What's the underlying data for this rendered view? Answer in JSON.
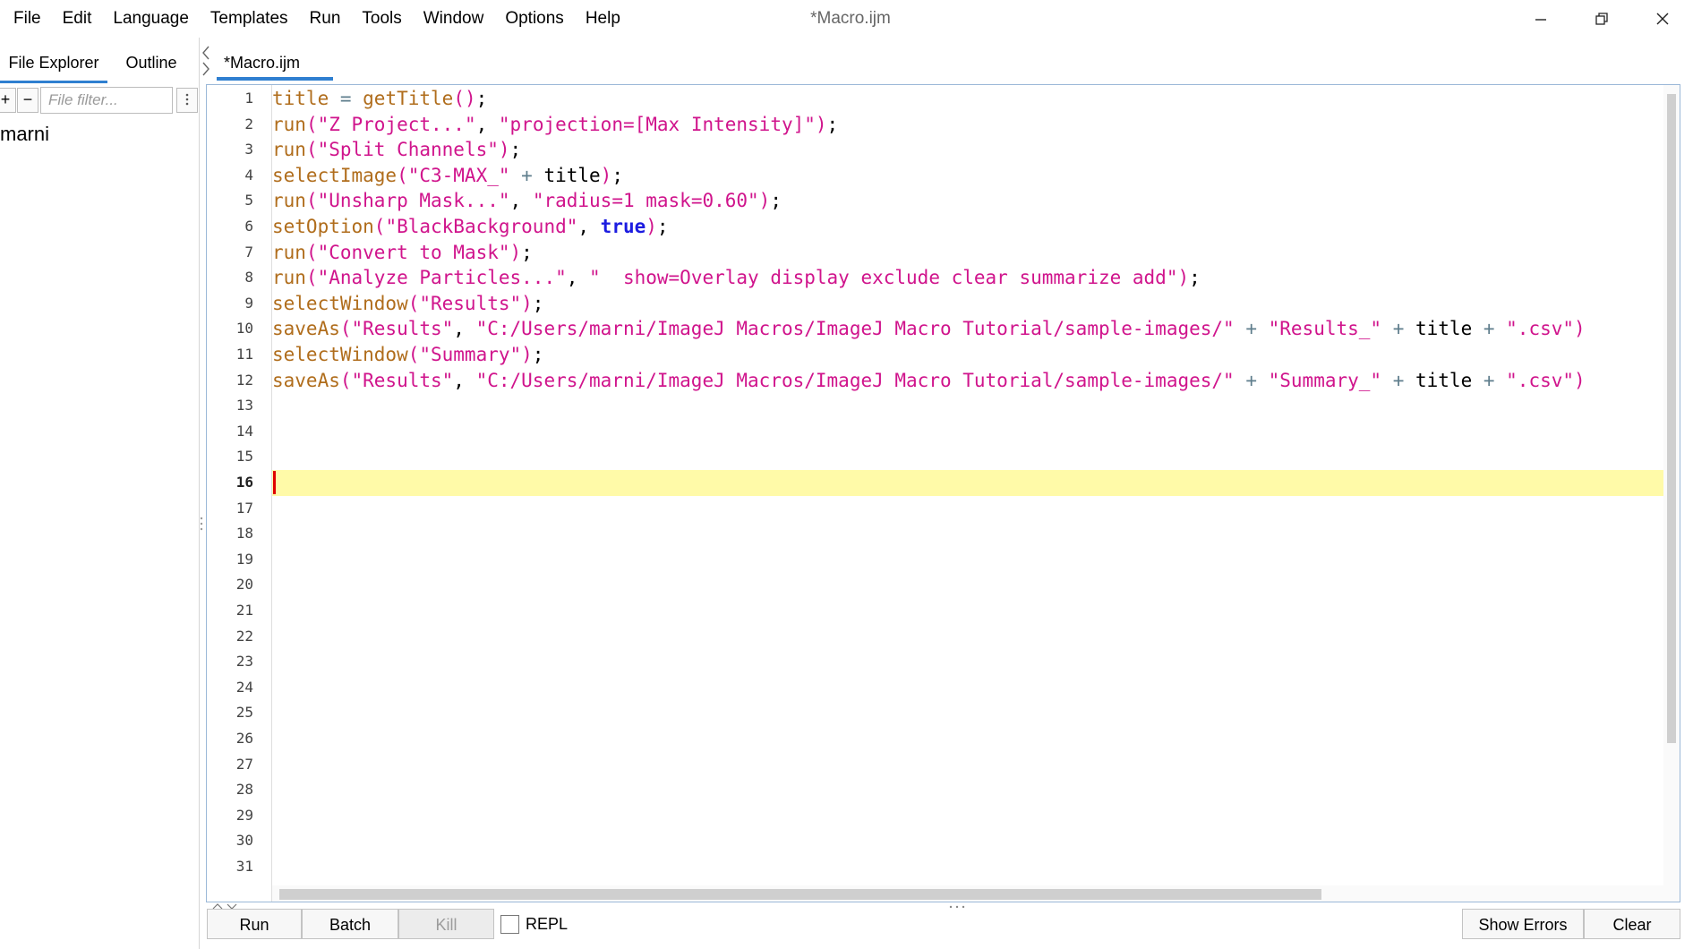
{
  "menu": [
    "File",
    "Edit",
    "Language",
    "Templates",
    "Run",
    "Tools",
    "Window",
    "Options",
    "Help"
  ],
  "window_title": "*Macro.ijm",
  "window_controls": [
    "minimize-icon",
    "restore-icon",
    "close-icon"
  ],
  "left_panel": {
    "tabs": [
      "File Explorer",
      "Outline"
    ],
    "active_tab": "File Explorer",
    "add_label": "+",
    "remove_label": "−",
    "filter_placeholder": "File filter...",
    "menu_icon": "more-vertical-icon",
    "tree_items": [
      "marni"
    ]
  },
  "editor": {
    "tab_label": "*Macro.ijm",
    "current_line": 16,
    "line_count": 31,
    "lines": [
      [
        [
          "fn",
          "title"
        ],
        [
          "op",
          " = "
        ],
        [
          "fn",
          "getTitle"
        ],
        [
          "str",
          "()"
        ],
        [
          "pl",
          ";"
        ]
      ],
      [
        [
          "fn",
          "run"
        ],
        [
          "str",
          "(\"Z Project...\""
        ],
        [
          "pl",
          ", "
        ],
        [
          "str",
          "\"projection=[Max Intensity]\")"
        ],
        [
          "pl",
          ";"
        ]
      ],
      [
        [
          "fn",
          "run"
        ],
        [
          "str",
          "(\"Split Channels\")"
        ],
        [
          "pl",
          ";"
        ]
      ],
      [
        [
          "fn",
          "selectImage"
        ],
        [
          "str",
          "(\"C3-MAX_\""
        ],
        [
          "op",
          " + "
        ],
        [
          "pl",
          "title"
        ],
        [
          "str",
          ")"
        ],
        [
          "pl",
          ";"
        ]
      ],
      [
        [
          "fn",
          "run"
        ],
        [
          "str",
          "(\"Unsharp Mask...\""
        ],
        [
          "pl",
          ", "
        ],
        [
          "str",
          "\"radius=1 mask=0.60\")"
        ],
        [
          "pl",
          ";"
        ]
      ],
      [
        [
          "fn",
          "setOption"
        ],
        [
          "str",
          "(\"BlackBackground\""
        ],
        [
          "pl",
          ", "
        ],
        [
          "kw",
          "true"
        ],
        [
          "str",
          ")"
        ],
        [
          "pl",
          ";"
        ]
      ],
      [
        [
          "fn",
          "run"
        ],
        [
          "str",
          "(\"Convert to Mask\")"
        ],
        [
          "pl",
          ";"
        ]
      ],
      [
        [
          "fn",
          "run"
        ],
        [
          "str",
          "(\"Analyze Particles...\""
        ],
        [
          "pl",
          ", "
        ],
        [
          "str",
          "\"  show=Overlay display exclude clear summarize add\")"
        ],
        [
          "pl",
          ";"
        ]
      ],
      [
        [
          "fn",
          "selectWindow"
        ],
        [
          "str",
          "(\"Results\")"
        ],
        [
          "pl",
          ";"
        ]
      ],
      [
        [
          "fn",
          "saveAs"
        ],
        [
          "str",
          "(\"Results\""
        ],
        [
          "pl",
          ", "
        ],
        [
          "str",
          "\"C:/Users/marni/ImageJ Macros/ImageJ Macro Tutorial/sample-images/\""
        ],
        [
          "op",
          " + "
        ],
        [
          "str",
          "\"Results_\""
        ],
        [
          "op",
          " + "
        ],
        [
          "pl",
          "title"
        ],
        [
          "op",
          " + "
        ],
        [
          "str",
          "\".csv\")"
        ]
      ],
      [
        [
          "fn",
          "selectWindow"
        ],
        [
          "str",
          "(\"Summary\")"
        ],
        [
          "pl",
          ";"
        ]
      ],
      [
        [
          "fn",
          "saveAs"
        ],
        [
          "str",
          "(\"Results\""
        ],
        [
          "pl",
          ", "
        ],
        [
          "str",
          "\"C:/Users/marni/ImageJ Macros/ImageJ Macro Tutorial/sample-images/\""
        ],
        [
          "op",
          " + "
        ],
        [
          "str",
          "\"Summary_\""
        ],
        [
          "op",
          " + "
        ],
        [
          "pl",
          "title"
        ],
        [
          "op",
          " + "
        ],
        [
          "str",
          "\".csv\")"
        ]
      ]
    ]
  },
  "toolbar": {
    "run_label": "Run",
    "batch_label": "Batch",
    "kill_label": "Kill",
    "repl_label": "REPL",
    "repl_checked": false,
    "show_errors_label": "Show Errors",
    "clear_label": "Clear"
  },
  "colors": {
    "accent": "#2f7fd0",
    "function": "#b06d1c",
    "string": "#d0148c",
    "keyword": "#1c1ce0",
    "current_line": "#fffaa8",
    "caret": "#e00000"
  }
}
